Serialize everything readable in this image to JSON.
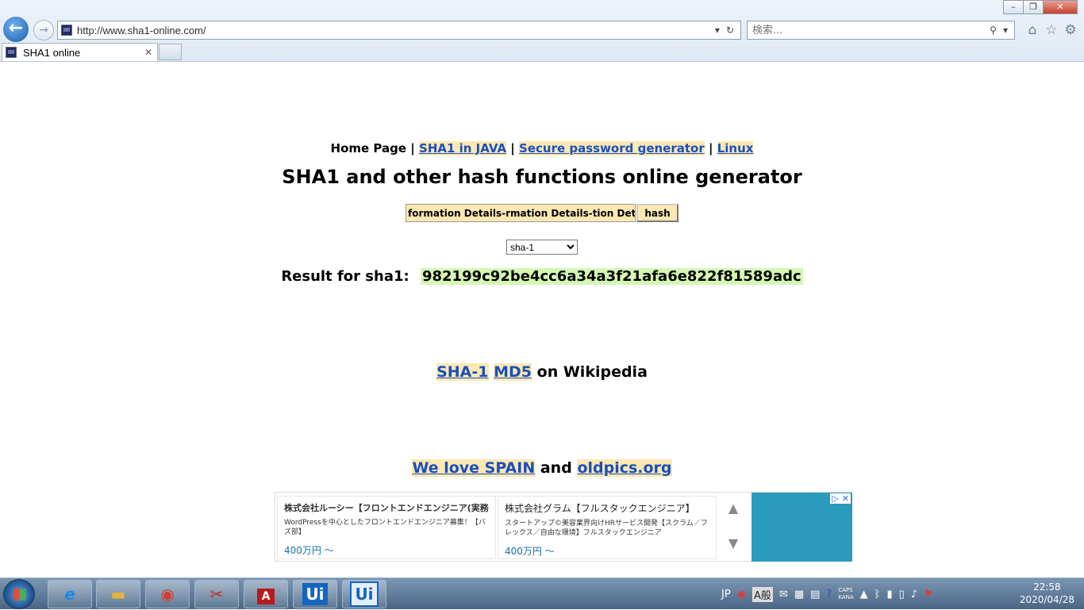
{
  "browser": {
    "window_controls": [
      "–",
      "❐",
      "✕"
    ],
    "address": {
      "url": "http://www.sha1-online.com/"
    },
    "search": {
      "placeholder": "検索..."
    },
    "tab": {
      "title": "SHA1 online",
      "close": "✕"
    }
  },
  "page": {
    "nav": {
      "home": "Home Page",
      "sep": "|",
      "links": [
        "SHA1 in JAVA",
        "Secure password generator",
        "Linux"
      ]
    },
    "title": "SHA1 and other hash functions online generator",
    "form": {
      "input_value": "formation Details-rmation Details-tion Details",
      "button_label": "hash",
      "algorithm": "sha-1"
    },
    "result": {
      "label": "Result for sha1:",
      "value": "982199c92be4cc6a34a3f21afa6e822f81589adc"
    },
    "wiki": {
      "link1": "SHA-1",
      "link2": "MD5",
      "suffix": "on Wikipedia"
    },
    "love": {
      "link1": "We love SPAIN",
      "and": "and",
      "link2": "oldpics.org"
    }
  },
  "ad": {
    "cards": [
      {
        "title": "株式会社ルーシー【フロントエンドエンジニア(実務不問)】",
        "desc": "WordPressを中心としたフロントエンドエンジニア募集！【バズ部】",
        "price": "400万円 〜"
      },
      {
        "title": "株式会社グラム【フルスタックエンジニア】",
        "desc": "スタートアップ©美容業界向けHRサービス開発【スクラム／フレックス／自由な環境】フルスタックエンジニア",
        "price": "400万円 〜"
      }
    ],
    "up": "▲",
    "down": "▼",
    "choices": [
      "▷",
      "✕"
    ]
  },
  "taskbar": {
    "apps": [
      "ie",
      "explorer",
      "chrome",
      "snipping-tool",
      "acrobat",
      "uipath",
      "uipath-studio"
    ],
    "pdf_label": "A",
    "ui_label": "Ui",
    "tray": {
      "lang": "JP",
      "ime": "A般",
      "caps": "CAPS",
      "kana": "KANA"
    },
    "clock": {
      "time": "22:58",
      "date": "2020/04/28"
    }
  }
}
